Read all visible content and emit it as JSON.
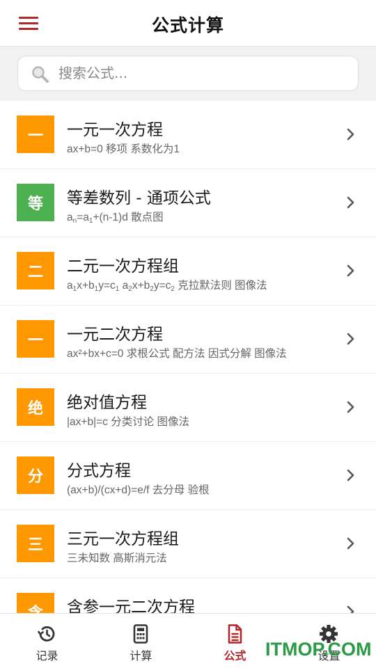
{
  "header": {
    "title": "公式计算"
  },
  "search": {
    "placeholder": "搜索公式..."
  },
  "colors": {
    "accent": "#b3262a",
    "orange": "#ff9800",
    "green": "#4caf50"
  },
  "items": [
    {
      "badge": "一",
      "badge_color": "#ff9800",
      "title": "一元一次方程",
      "subtitle": "ax+b=0 移项 系数化为1"
    },
    {
      "badge": "等",
      "badge_color": "#4caf50",
      "title": "等差数列 - 通项公式",
      "subtitle_html": "a<sub>n</sub>=a<sub>1</sub>+(n-1)d 散点图"
    },
    {
      "badge": "二",
      "badge_color": "#ff9800",
      "title": "二元一次方程组",
      "subtitle_html": "a<sub>1</sub>x+b<sub>1</sub>y=c<sub>1</sub> a<sub>2</sub>x+b<sub>2</sub>y=c<sub>2</sub> 克拉默法则 图像法"
    },
    {
      "badge": "一",
      "badge_color": "#ff9800",
      "title": "一元二次方程",
      "subtitle": "ax²+bx+c=0 求根公式 配方法 因式分解 图像法"
    },
    {
      "badge": "绝",
      "badge_color": "#ff9800",
      "title": "绝对值方程",
      "subtitle": "|ax+b|=c 分类讨论 图像法"
    },
    {
      "badge": "分",
      "badge_color": "#ff9800",
      "title": "分式方程",
      "subtitle": "(ax+b)/(cx+d)=e/f 去分母 验根"
    },
    {
      "badge": "三",
      "badge_color": "#ff9800",
      "title": "三元一次方程组",
      "subtitle": "三未知数 高斯消元法"
    },
    {
      "badge": "含",
      "badge_color": "#ff9800",
      "title": "含参一元二次方程",
      "subtitle": ""
    }
  ],
  "tabs": [
    {
      "label": "记录",
      "icon": "history-icon",
      "active": false
    },
    {
      "label": "计算",
      "icon": "calculator-icon",
      "active": false
    },
    {
      "label": "公式",
      "icon": "document-icon",
      "active": true
    },
    {
      "label": "设置",
      "icon": "gear-icon",
      "active": false
    }
  ],
  "watermark": {
    "text": "ITMOP.COM"
  }
}
